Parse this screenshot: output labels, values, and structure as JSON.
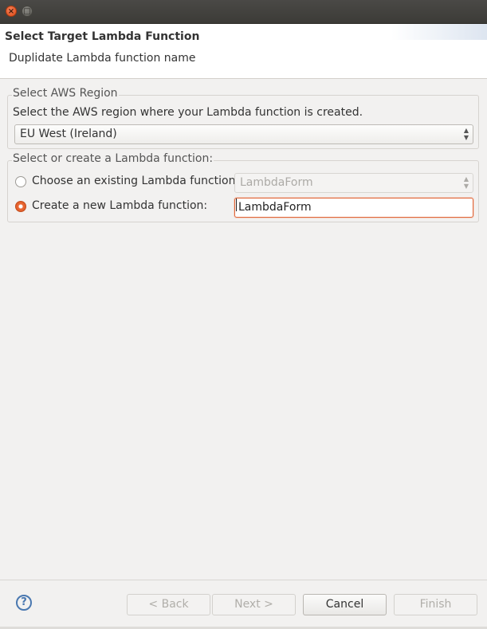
{
  "header": {
    "title": "Select Target Lambda Function",
    "message": "Duplidate Lambda function name"
  },
  "region_group": {
    "label": "Select AWS Region",
    "description": "Select the AWS region where your Lambda function is created.",
    "selected_region": "EU West (Ireland)"
  },
  "lambda_group": {
    "label": "Select or create a Lambda function:",
    "existing_option_label": "Choose an existing Lambda function:",
    "existing_option_checked": false,
    "existing_function_value": "LambdaForm",
    "new_option_label": "Create a new Lambda function:",
    "new_option_checked": true,
    "new_function_value": "LambdaForm"
  },
  "footer": {
    "help_symbol": "?",
    "back_label": "< Back",
    "next_label": "Next >",
    "cancel_label": "Cancel",
    "finish_label": "Finish"
  },
  "icons": {
    "close": "close-icon",
    "maximize": "maximize-icon",
    "combo_arrows": "updown-chevron-icon",
    "help": "help-icon"
  },
  "colors": {
    "accent_orange": "#e05a25",
    "title_bar": "#3c3b37",
    "dialog_bg": "#f2f1f0"
  }
}
